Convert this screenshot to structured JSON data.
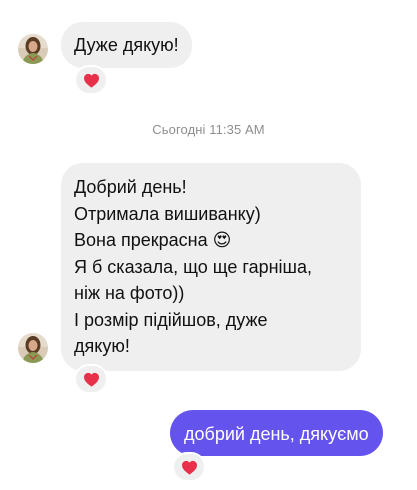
{
  "colors": {
    "incoming_bubble": "#efefef",
    "outgoing_bubble": "#6553ee",
    "reaction_heart": "#e8304a",
    "timestamp_text": "#8e8e8e"
  },
  "messages": [
    {
      "direction": "incoming",
      "lines": [
        "Дуже дякую!"
      ],
      "reaction": "heart-icon"
    },
    {
      "direction": "incoming",
      "lines": [
        "Добрий день!",
        "Отримала вишиванку)",
        "Вона прекрасна 😍",
        "Я б сказала, що ще гарніша,",
        "ніж на фото))",
        "І розмір підійшов, дуже",
        "дякую!"
      ],
      "reaction": "heart-icon"
    },
    {
      "direction": "outgoing",
      "lines": [
        "добрий день, дякуємо"
      ],
      "reaction": "heart-icon"
    }
  ],
  "timestamp": "Сьогодні 11:35 AM"
}
